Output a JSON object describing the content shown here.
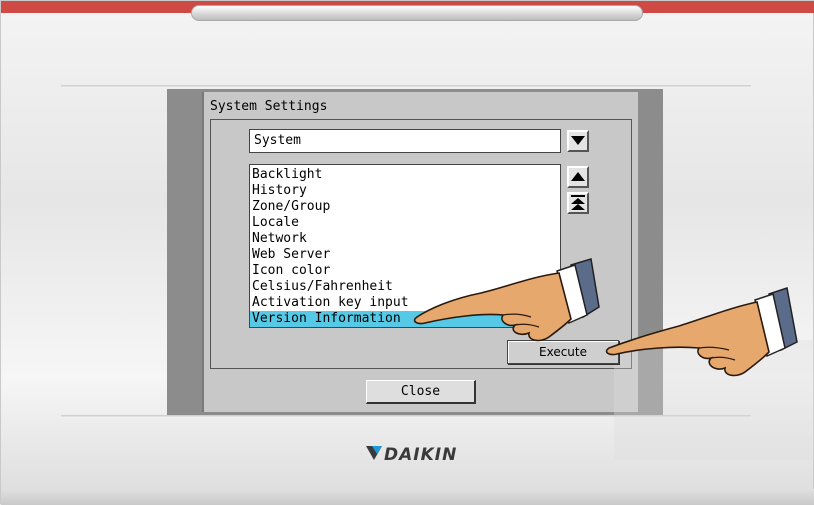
{
  "window": {
    "title": "System Settings"
  },
  "category_select": {
    "value": "System"
  },
  "settings_list": {
    "items": [
      "Backlight",
      "History",
      "Zone/Group",
      "Locale",
      "Network",
      "Web Server",
      "Icon color",
      "Celsius/Fahrenheit",
      "Activation key input",
      "Version Information"
    ],
    "selected_index": 9
  },
  "buttons": {
    "execute_label": "Execute",
    "close_label": "Close"
  },
  "brand": {
    "logo_text": "DAIKIN"
  },
  "icons": {
    "dropdown": "chevron-down-icon",
    "scroll_up": "triangle-up-icon",
    "scroll_top": "double-triangle-up-icon",
    "pointer": "pointing-hand-icon"
  },
  "colors": {
    "selection": "#55c9e6",
    "device_red_accent": "#cf4a45",
    "screen_bg": "#c8c8c8"
  }
}
